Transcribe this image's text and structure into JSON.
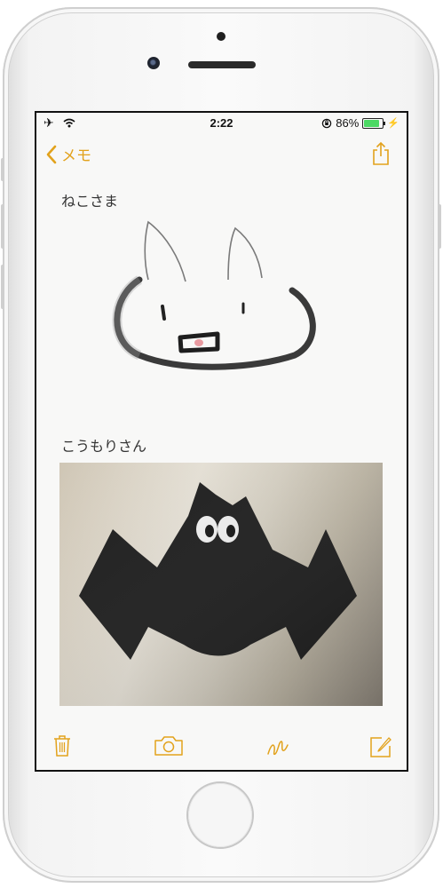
{
  "status_bar": {
    "time": "2:22",
    "battery_percent": "86%",
    "battery_level": 0.86
  },
  "nav": {
    "back_label": "メモ"
  },
  "note": {
    "text1": "ねこさま",
    "text2": "こうもりさん"
  },
  "colors": {
    "accent": "#e2a21c",
    "battery": "#4cd964"
  },
  "icons": [
    "airplane-icon",
    "wifi-icon",
    "rotation-lock-icon",
    "battery-icon",
    "chevron-left-icon",
    "share-icon",
    "trash-icon",
    "camera-icon",
    "sketch-icon",
    "compose-icon"
  ]
}
